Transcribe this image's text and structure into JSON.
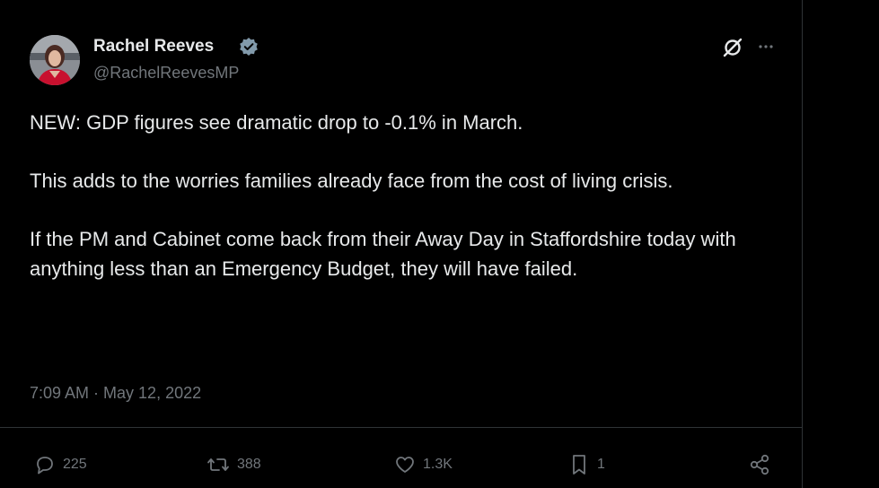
{
  "tweet": {
    "author_name": "Rachel Reeves",
    "author_handle": "@RachelReevesMP",
    "paragraphs": [
      "NEW: GDP figures see dramatic drop to -0.1% in March.",
      "This adds to the worries families already face from the cost of living crisis.",
      "If the PM and Cabinet come back from their Away Day in Staffordshire today with anything less than an Emergency Budget, they will have failed."
    ],
    "timestamp": "7:09 AM · May 12, 2022"
  },
  "actions": {
    "replies": "225",
    "retweets": "388",
    "likes": "1.3K",
    "bookmarks": "1"
  },
  "icons": {
    "verified": "verified-badge-icon",
    "grok": "grok-icon",
    "more": "more-icon",
    "reply": "reply-icon",
    "retweet": "retweet-icon",
    "like": "heart-icon",
    "bookmark": "bookmark-icon",
    "share": "share-icon"
  },
  "colors": {
    "background": "#000000",
    "text": "#e7e9ea",
    "muted": "#71767b",
    "verified": "#829aab"
  }
}
